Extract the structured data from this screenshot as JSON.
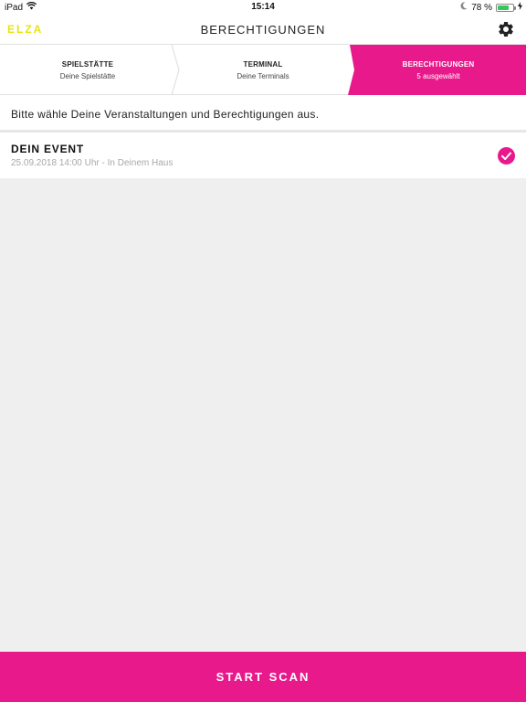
{
  "status_bar": {
    "device": "iPad",
    "time": "15:14",
    "battery_text": "78 %",
    "battery_level": 0.78
  },
  "nav": {
    "logo": "ELZA",
    "title": "BERECHTIGUNGEN"
  },
  "steps": [
    {
      "title": "SPIELSTÄTTE",
      "subtitle": "Deine Spielstätte",
      "active": false
    },
    {
      "title": "TERMINAL",
      "subtitle": "Deine Terminals",
      "active": false
    },
    {
      "title": "BERECHTIGUNGEN",
      "subtitle": "5 ausgewählt",
      "active": true
    }
  ],
  "instruction": "Bitte wähle Deine Veranstaltungen und Berechtigungen aus.",
  "events": [
    {
      "title": "DEIN EVENT",
      "subtitle": "25.09.2018 14:00 Uhr - In Deinem Haus",
      "checked": true
    }
  ],
  "start_button": "START SCAN",
  "colors": {
    "accent": "#e8198b",
    "logo_accent": "#e5e514",
    "background": "#efefef"
  },
  "icons": [
    "wifi-icon",
    "moon-icon",
    "battery-icon",
    "charging-icon",
    "gear-icon",
    "checkmark-icon"
  ]
}
